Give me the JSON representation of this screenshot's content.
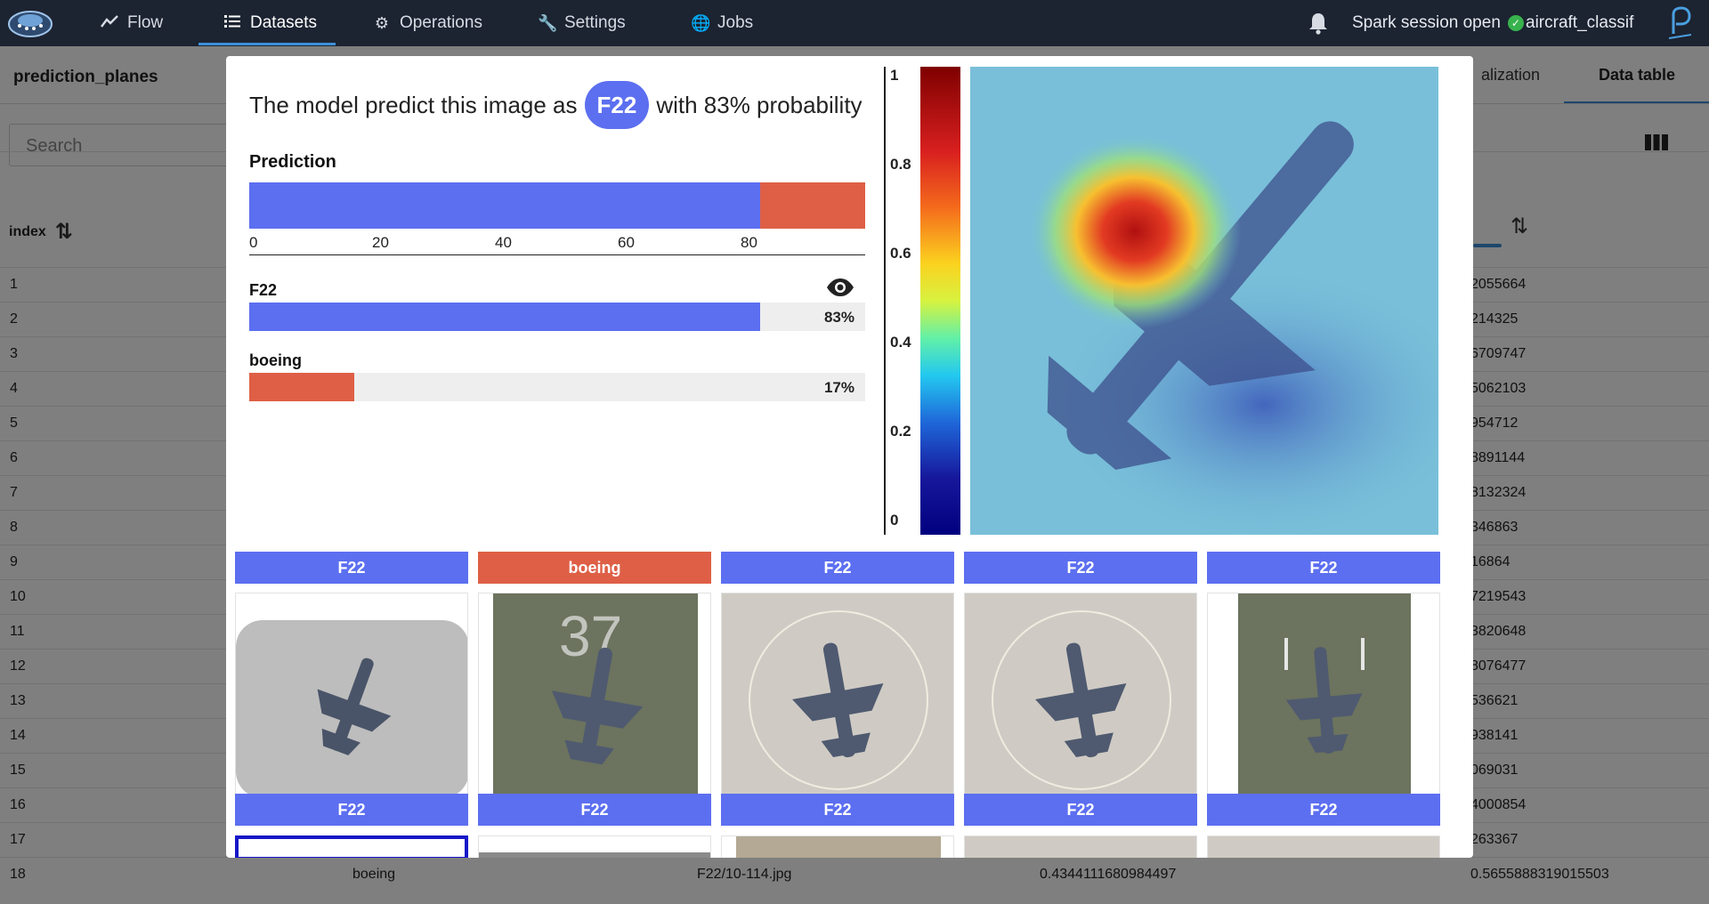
{
  "nav": {
    "items": [
      {
        "label": "Flow",
        "icon": "flow-icon"
      },
      {
        "label": "Datasets",
        "icon": "list-icon"
      },
      {
        "label": "Operations",
        "icon": "gear-icon"
      },
      {
        "label": "Settings",
        "icon": "wrench-icon"
      },
      {
        "label": "Jobs",
        "icon": "globe-search-icon"
      }
    ],
    "active": "Datasets",
    "session_status": "Spark session open",
    "project": "aircraft_classif"
  },
  "dataset": {
    "title": "prediction_planes",
    "search_placeholder": "Search",
    "tabs": [
      "alization",
      "Data table"
    ],
    "active_tab": "Data table",
    "index_header": "index",
    "rows": [
      {
        "index": "1",
        "last": "2055664"
      },
      {
        "index": "2",
        "last": "214325"
      },
      {
        "index": "3",
        "last": "6709747"
      },
      {
        "index": "4",
        "last": "5062103"
      },
      {
        "index": "5",
        "last": "954712"
      },
      {
        "index": "6",
        "last": "8891144"
      },
      {
        "index": "7",
        "last": "8132324"
      },
      {
        "index": "8",
        "last": "346863"
      },
      {
        "index": "9",
        "last": "16864"
      },
      {
        "index": "10",
        "last": "7219543"
      },
      {
        "index": "11",
        "last": "3820648"
      },
      {
        "index": "12",
        "last": "8076477"
      },
      {
        "index": "13",
        "last": "536621"
      },
      {
        "index": "14",
        "last": "938141"
      },
      {
        "index": "15",
        "last": "069031"
      },
      {
        "index": "16",
        "last": "4000854"
      },
      {
        "index": "17",
        "last": "263367"
      },
      {
        "index": "18",
        "label": "boeing",
        "path": "F22/10-114.jpg",
        "p1": "0.4344111680984497",
        "last": "0.5655888319015503"
      }
    ]
  },
  "modal": {
    "sentence_before": "The model predict this image as",
    "predicted_label": "F22",
    "sentence_after": "with 83% probability",
    "prediction_title": "Prediction",
    "axis_ticks": [
      "0",
      "20",
      "40",
      "60",
      "80"
    ],
    "classes": [
      {
        "name": "F22",
        "probability": 0.83,
        "label": "83%",
        "color": "#5c6ff0"
      },
      {
        "name": "boeing",
        "probability": 0.17,
        "label": "17%",
        "color": "#de5f46"
      }
    ],
    "colorbar_ticks": [
      "1",
      "0.8",
      "0.6",
      "0.4",
      "0.2",
      "0"
    ],
    "top_captions": [
      {
        "label": "F22",
        "color": "#5c6ff0"
      },
      {
        "label": "boeing",
        "color": "#de5f46"
      },
      {
        "label": "F22",
        "color": "#5c6ff0"
      },
      {
        "label": "F22",
        "color": "#5c6ff0"
      },
      {
        "label": "F22",
        "color": "#5c6ff0"
      }
    ],
    "bottom_captions": [
      {
        "label": "F22",
        "color": "#5c6ff0"
      },
      {
        "label": "F22",
        "color": "#5c6ff0"
      },
      {
        "label": "F22",
        "color": "#5c6ff0"
      },
      {
        "label": "F22",
        "color": "#5c6ff0"
      },
      {
        "label": "F22",
        "color": "#5c6ff0"
      }
    ]
  }
}
